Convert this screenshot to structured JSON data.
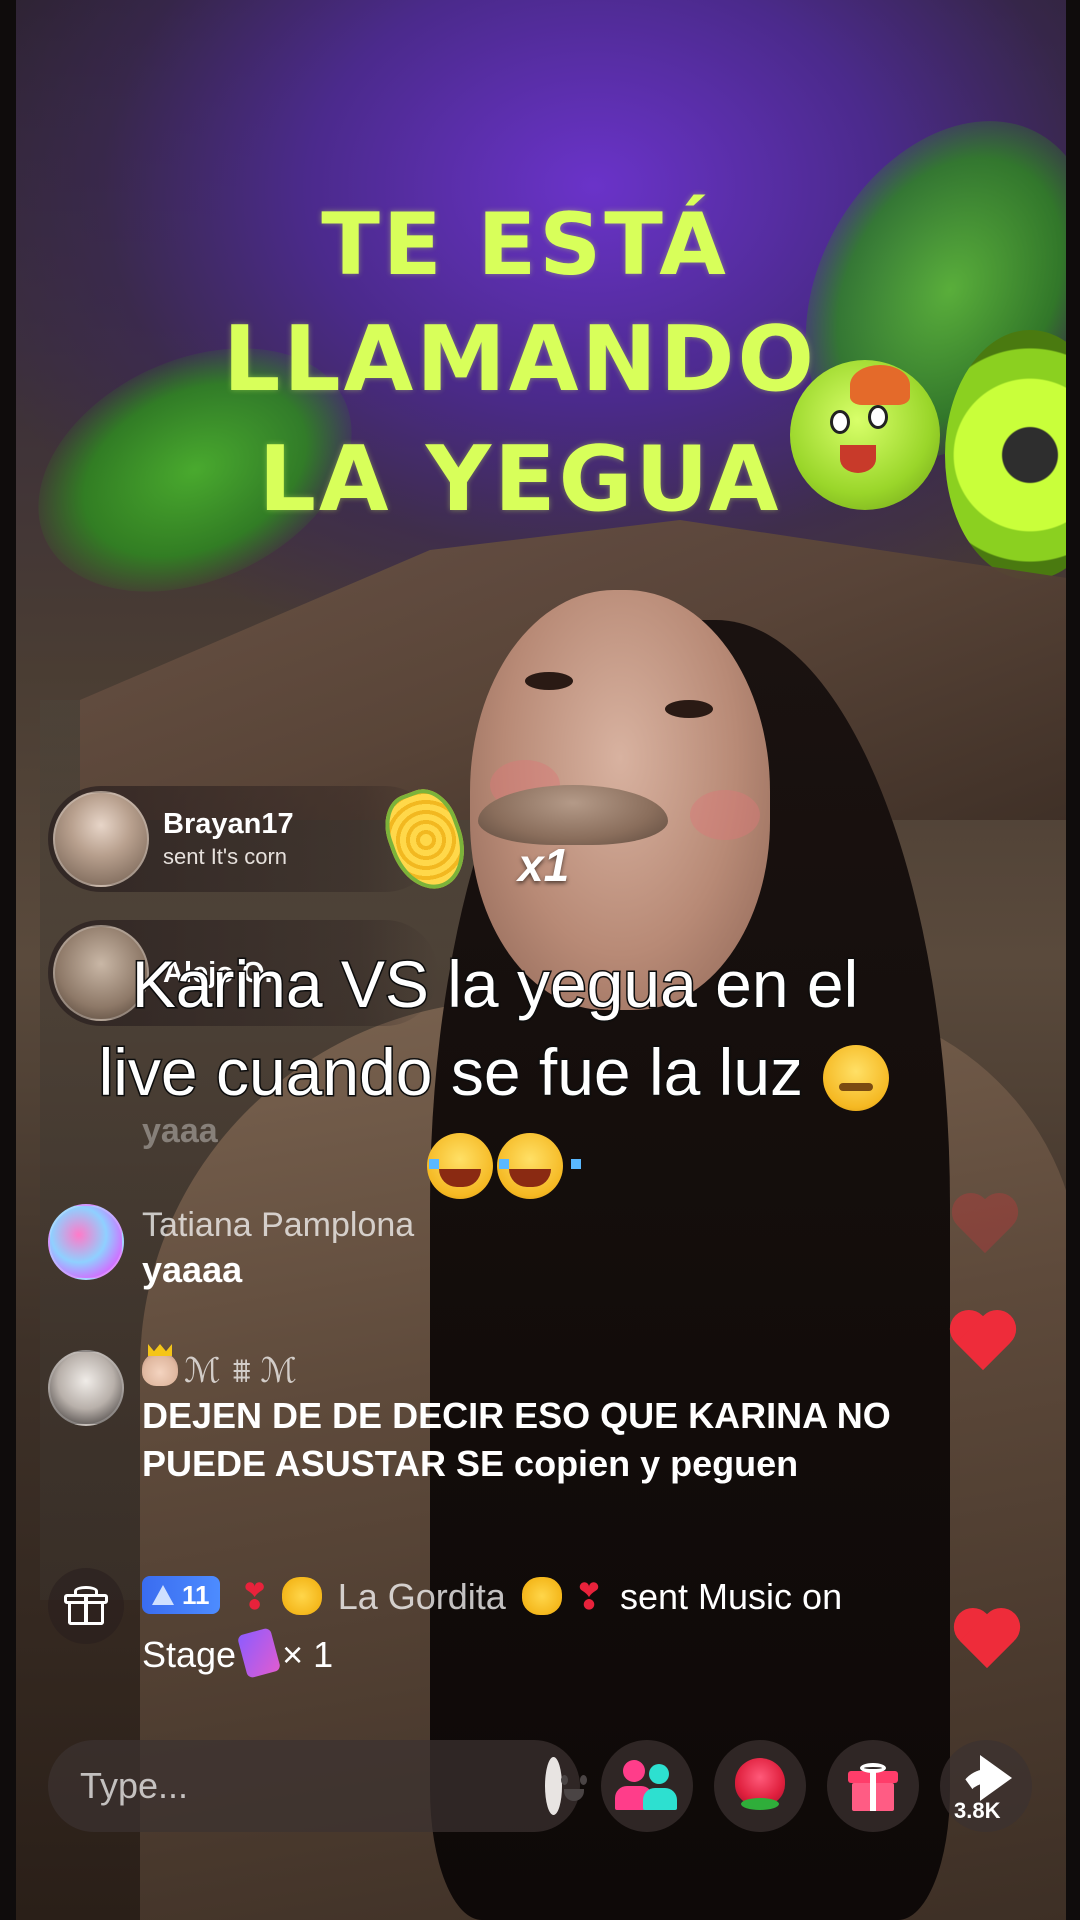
{
  "sign": {
    "line1": "TE ESTÁ",
    "line2": "LLAMANDO",
    "line3": "LA YEGUA"
  },
  "gift_banners": [
    {
      "name": "Brayan17",
      "subtitle": "sent It's corn",
      "combo": "x1",
      "gift_icon": "corn-icon"
    },
    {
      "name": "Alejo O.",
      "subtitle": ""
    }
  ],
  "caption": {
    "line1": "Karina VS la yegua en el",
    "line2": "live cuando se fue la luz",
    "emoji_line2": "pensive-emoji",
    "emoji_line3": [
      "joy-emoji",
      "joy-emoji"
    ]
  },
  "chat": {
    "faded_message": "yaaa",
    "messages": [
      {
        "user": "Tatiana Pamplona",
        "message": "yaaaa"
      },
      {
        "user": "ℳ  ⩩ ℳ",
        "user_prefix_icon": "crown-princess-icon",
        "message": "DEJEN DE DE DECIR ESO QUE KARINA NO PUEDE ASUSTAR SE copien y peguen"
      }
    ],
    "gift_event": {
      "level": "11",
      "user": "La Gordita",
      "text_before_gift": "sent Music on",
      "gift_name_line2": "Stage",
      "count": "× 1"
    }
  },
  "bottom_bar": {
    "input_placeholder": "Type...",
    "share_count": "3.8K"
  },
  "colors": {
    "sign_text": "#d8ff5a",
    "heart": "#ee2c3a",
    "level_badge": "#3a6cf0"
  }
}
